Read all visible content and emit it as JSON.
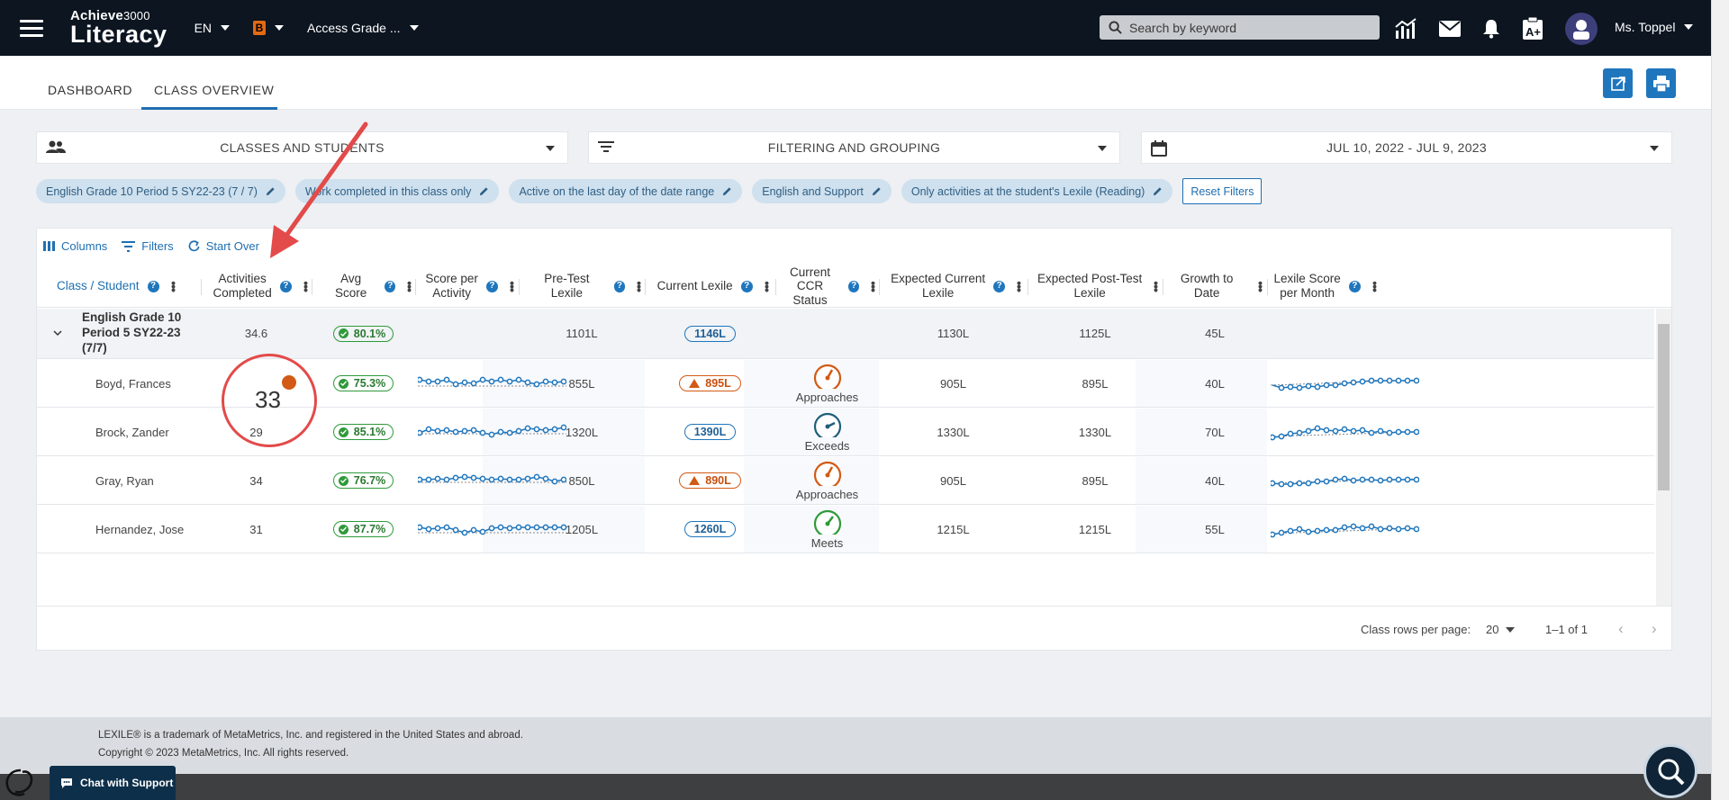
{
  "topbar": {
    "logo_small": "Achieve",
    "logo_small_num": "3000",
    "logo_big": "Literacy",
    "language": "EN",
    "level_badge": "B",
    "grade_selector": "Access Grade ...",
    "search_placeholder": "Search by keyword",
    "user_name": "Ms. Toppel"
  },
  "tabs": [
    {
      "label": "DASHBOARD"
    },
    {
      "label": "CLASS OVERVIEW"
    }
  ],
  "filters": {
    "classes": "CLASSES AND STUDENTS",
    "filtering": "FILTERING AND GROUPING",
    "date_range": "JUL 10, 2022 - JUL 9, 2023"
  },
  "chips": [
    "English Grade 10 Period 5 SY22-23 (7 / 7)",
    "Work completed in this class only",
    "Active on the last day of the date range",
    "English and Support",
    "Only activities at the student's Lexile (Reading)"
  ],
  "reset_label": "Reset Filters",
  "toolbar": {
    "columns": "Columns",
    "filters": "Filters",
    "start_over": "Start Over"
  },
  "columns": {
    "c1": "Class / Student",
    "c2a": "Activities",
    "c2b": "Completed",
    "c3": "Avg Score",
    "c4a": "Score per",
    "c4b": "Activity",
    "c5": "Pre-Test Lexile",
    "c6": "Current Lexile",
    "c7a": "Current",
    "c7b": "CCR Status",
    "c8a": "Expected Current",
    "c8b": "Lexile",
    "c9a": "Expected Post-Test",
    "c9b": "Lexile",
    "c10": "Growth to Date",
    "c11a": "Lexile Score",
    "c11b": "per Month"
  },
  "class_row": {
    "name_l1": "English Grade 10",
    "name_l2": "Period 5 SY22-23",
    "name_l3": "(7/7)",
    "activities": "34.6",
    "avg_score": "80.1%",
    "pretest": "1101L",
    "current": "1146L",
    "expected_current": "1130L",
    "expected_post": "1125L",
    "growth": "45L"
  },
  "students": [
    {
      "name": "Boyd, Frances",
      "activities": "33",
      "avg": "75.3%",
      "pretest": "855L",
      "current": "895L",
      "current_warn": true,
      "ccr": "Approaches",
      "exp_cur": "905L",
      "exp_post": "895L",
      "growth": "40L"
    },
    {
      "name": "Brock, Zander",
      "activities": "29",
      "avg": "85.1%",
      "pretest": "1320L",
      "current": "1390L",
      "current_warn": false,
      "ccr": "Exceeds",
      "exp_cur": "1330L",
      "exp_post": "1330L",
      "growth": "70L"
    },
    {
      "name": "Gray, Ryan",
      "activities": "34",
      "avg": "76.7%",
      "pretest": "850L",
      "current": "890L",
      "current_warn": true,
      "ccr": "Approaches",
      "exp_cur": "905L",
      "exp_post": "895L",
      "growth": "40L"
    },
    {
      "name": "Hernandez, Jose",
      "activities": "31",
      "avg": "87.7%",
      "pretest": "1205L",
      "current": "1260L",
      "current_warn": false,
      "ccr": "Meets",
      "exp_cur": "1215L",
      "exp_post": "1215L",
      "growth": "55L"
    }
  ],
  "pagination": {
    "label": "Class rows per page:",
    "per_page": "20",
    "range": "1–1 of 1"
  },
  "footer": {
    "line1": "LEXILE® is a trademark of MetaMetrics, Inc. and registered in the United States and abroad.",
    "line2": "Copyright © 2023 MetaMetrics, Inc. All rights reserved."
  },
  "chat_label": "Chat with Support",
  "colors": {
    "topbar": "#0c1520",
    "accent": "#1f76bd",
    "approaches": "#d25a14",
    "exceeds": "#1f5f7a",
    "meets": "#2f9a3a",
    "annotation": "#e34a4a"
  }
}
